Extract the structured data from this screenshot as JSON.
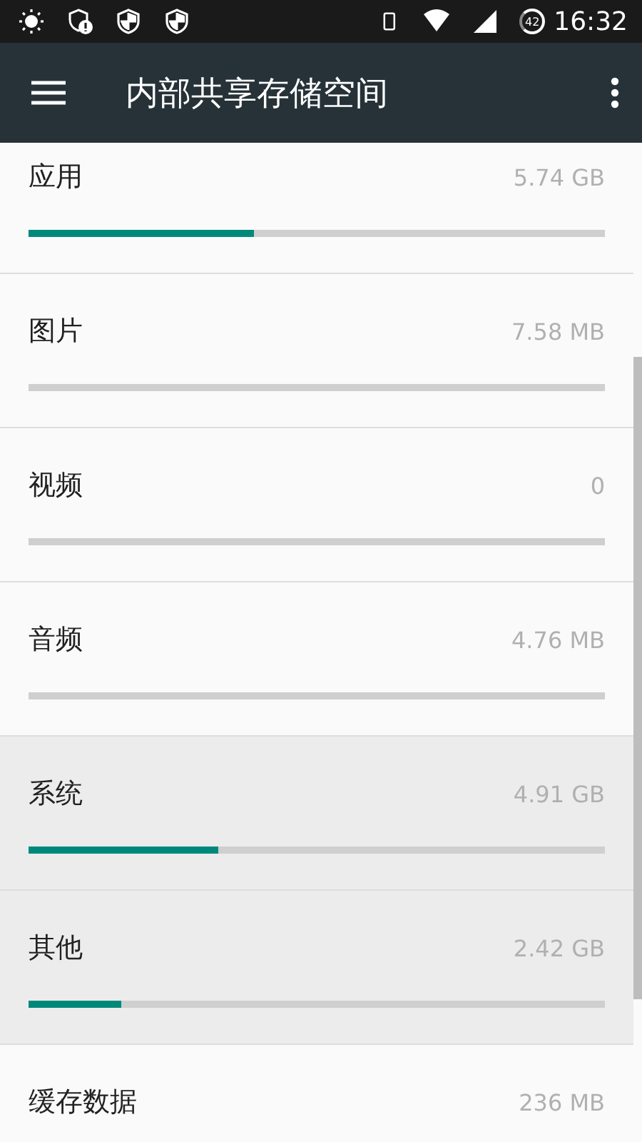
{
  "status_bar": {
    "battery": "42",
    "time": "16:32"
  },
  "toolbar": {
    "title": "内部共享存储空间"
  },
  "items": [
    {
      "label": "应用",
      "size": "5.74 GB",
      "level": 0.39,
      "pressed": false
    },
    {
      "label": "图片",
      "size": "7.58 MB",
      "level": 0,
      "pressed": false
    },
    {
      "label": "视频",
      "size": "0",
      "level": 0,
      "pressed": false
    },
    {
      "label": "音频",
      "size": "4.76 MB",
      "level": 0,
      "pressed": false
    },
    {
      "label": "系统",
      "size": "4.91 GB",
      "level": 0.33,
      "pressed": true
    },
    {
      "label": "其他",
      "size": "2.42 GB",
      "level": 0.16,
      "pressed": true
    },
    {
      "label": "缓存数据",
      "size": "236 MB",
      "pressed": false
    }
  ]
}
